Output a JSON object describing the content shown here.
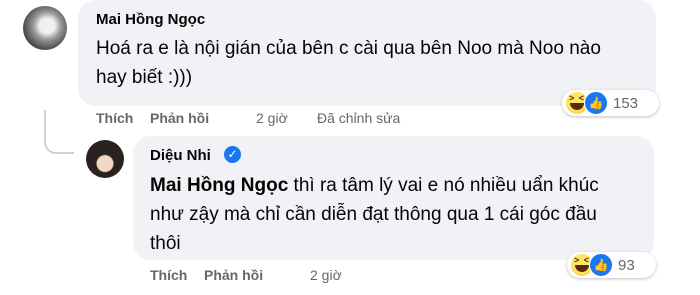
{
  "comment1": {
    "author": "Mai Hồng Ngọc",
    "text": "Hoá ra e là nội gián của bên c cài qua bên Noo mà Noo nào hay biết :)))",
    "actions": {
      "like": "Thích",
      "reply": "Phản hồi",
      "time": "2 giờ",
      "edited": "Đã chỉnh sửa"
    },
    "reaction_count": "153",
    "reaction_icons": [
      "haha-icon",
      "like-icon"
    ]
  },
  "comment2": {
    "author": "Diệu Nhi",
    "mention": "Mai Hồng Ngọc",
    "text": " thì ra tâm lý vai e nó nhiều uẩn khúc như zậy mà chỉ cần diễn đạt thông qua 1 cái góc đầu thôi",
    "actions": {
      "like": "Thích",
      "reply": "Phản hồi",
      "time": "2 giờ"
    },
    "reaction_count": "93",
    "reaction_icons": [
      "haha-icon"
    ]
  },
  "colors": {
    "bubble": "#f0f2f5",
    "meta_text": "#65676b",
    "verified": "#1877f2"
  }
}
